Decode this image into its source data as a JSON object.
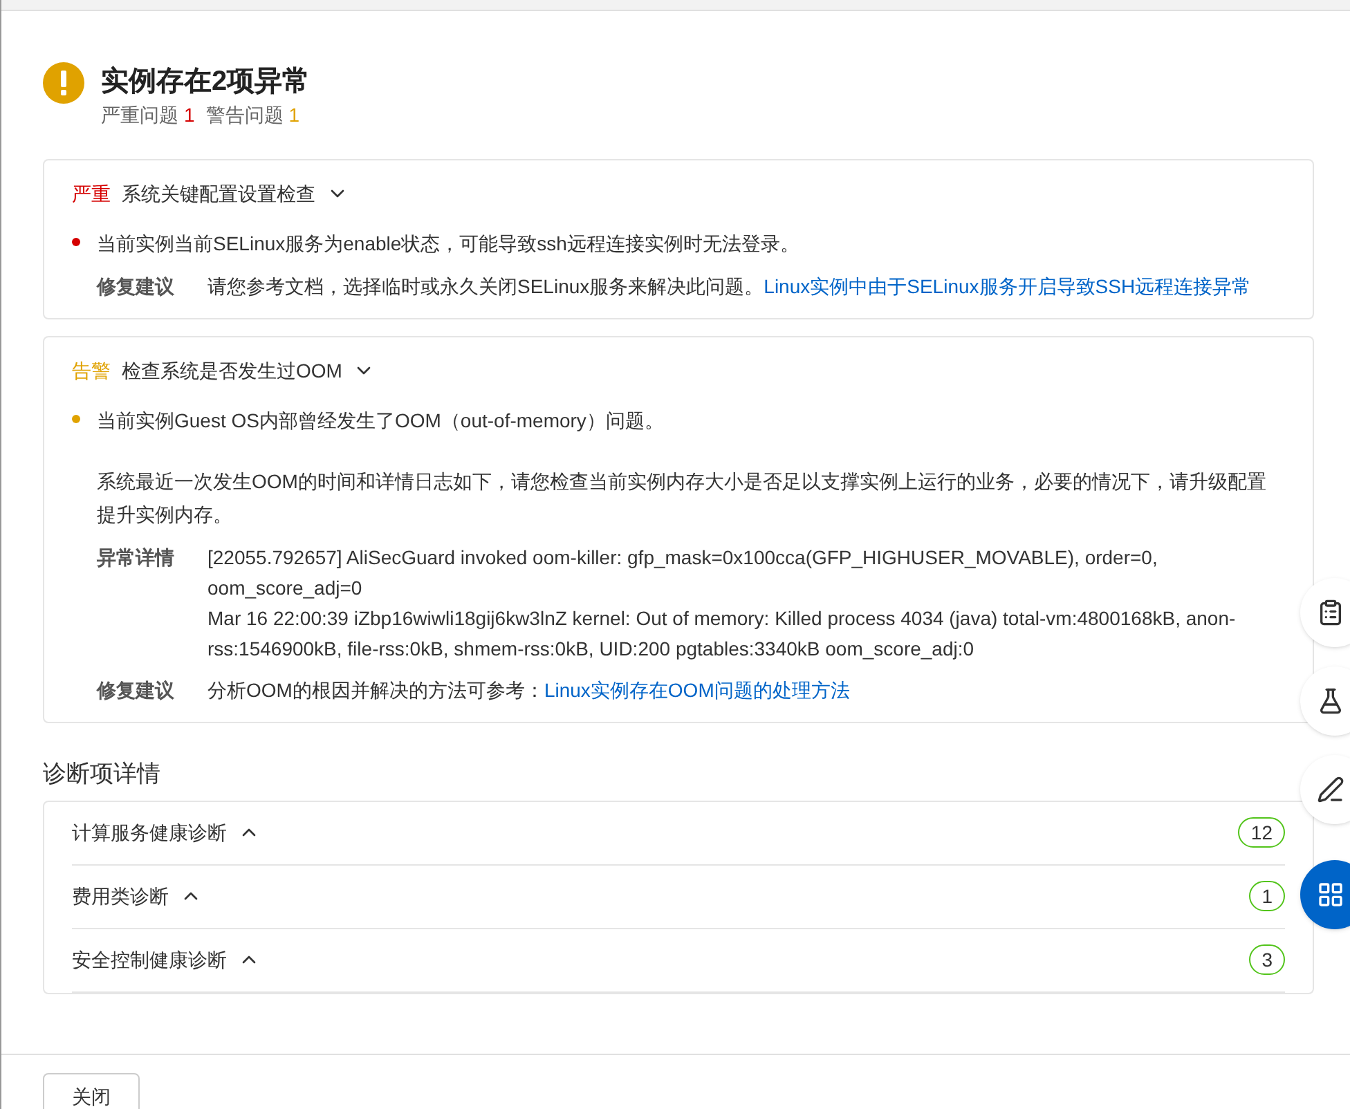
{
  "header": {
    "title": "实例存在2项异常",
    "summary": [
      {
        "label": "严重问题",
        "count": "1",
        "kind": "critical"
      },
      {
        "label": "警告问题",
        "count": "1",
        "kind": "warning"
      }
    ]
  },
  "issues": [
    {
      "kind": "critical",
      "severity": "严重",
      "title": "系统关键配置设置检查",
      "expanded": true,
      "description": "当前实例当前SELinux服务为enable状态，可能导致ssh远程连接实例时无法登录。",
      "details": [
        {
          "label": "修复建议",
          "text": "请您参考文档，选择临时或永久关闭SELinux服务来解决此问题。",
          "link": "Linux实例中由于SELinux服务开启导致SSH远程连接异常"
        }
      ]
    },
    {
      "kind": "warning",
      "severity": "告警",
      "title": "检查系统是否发生过OOM",
      "expanded": true,
      "description": "当前实例Guest OS内部曾经发生了OOM（out-of-memory）问题。",
      "note": "系统最近一次发生OOM的时间和详情日志如下，请您检查当前实例内存大小是否足以支撑实例上运行的业务，必要的情况下，请升级配置提升实例内存。",
      "details": [
        {
          "label": "异常详情",
          "lines": [
            "[22055.792657] AliSecGuard invoked oom-killer: gfp_mask=0x100cca(GFP_HIGHUSER_MOVABLE), order=0, oom_score_adj=0",
            "Mar 16 22:00:39 iZbp16wiwli18gij6kw3lnZ kernel: Out of memory: Killed process 4034 (java) total-vm:4800168kB, anon-rss:1546900kB, file-rss:0kB, shmem-rss:0kB, UID:200 pgtables:3340kB oom_score_adj:0"
          ]
        },
        {
          "label": "修复建议",
          "text": "分析OOM的根因并解决的方法可参考：",
          "link": "Linux实例存在OOM问题的处理方法"
        }
      ]
    }
  ],
  "diagnostics": {
    "title": "诊断项详情",
    "items": [
      {
        "name": "计算服务健康诊断",
        "count": "12",
        "expanded": true
      },
      {
        "name": "费用类诊断",
        "count": "1",
        "expanded": true
      },
      {
        "name": "安全控制健康诊断",
        "count": "3",
        "expanded": true
      }
    ]
  },
  "close_button": "关闭"
}
